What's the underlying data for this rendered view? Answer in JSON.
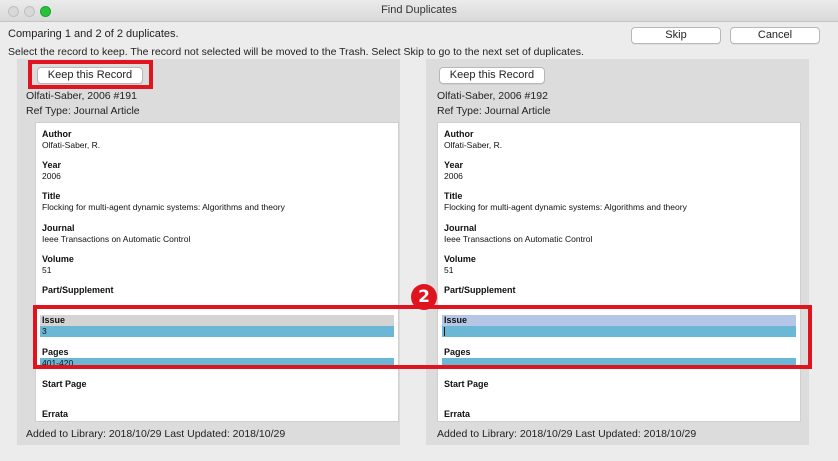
{
  "window": {
    "title": "Find Duplicates"
  },
  "info": {
    "comparing": "Comparing 1 and 2 of 2 duplicates.",
    "instructions": "Select the record to keep. The record not selected will be moved to the Trash. Select Skip to go to the next set of duplicates."
  },
  "buttons": {
    "skip": "Skip",
    "cancel": "Cancel"
  },
  "records": [
    {
      "keep_label": "Keep this Record",
      "name": "Olfati-Saber, 2006 #191",
      "ref_type": "Ref Type:  Journal Article",
      "fields": {
        "author_label": "Author",
        "author": "Olfati-Saber, R.",
        "year_label": "Year",
        "year": "2006",
        "title_label": "Title",
        "title": "Flocking for multi-agent dynamic systems: Algorithms and theory",
        "journal_label": "Journal",
        "journal": "Ieee Transactions on Automatic Control",
        "volume_label": "Volume",
        "volume": "51",
        "part_label": "Part/Supplement",
        "issue_label": "Issue",
        "issue": "3",
        "pages_label": "Pages",
        "pages": "401-420",
        "start_page_label": "Start Page",
        "errata_label": "Errata"
      },
      "footer": "Added to Library: 2018/10/29   Last Updated: 2018/10/29"
    },
    {
      "keep_label": "Keep this Record",
      "name": "Olfati-Saber, 2006 #192",
      "ref_type": "Ref Type:  Journal Article",
      "fields": {
        "author_label": "Author",
        "author": "Olfati-Saber, R.",
        "year_label": "Year",
        "year": "2006",
        "title_label": "Title",
        "title": "Flocking for multi-agent dynamic systems: Algorithms and theory",
        "journal_label": "Journal",
        "journal": "Ieee Transactions on Automatic Control",
        "volume_label": "Volume",
        "volume": "51",
        "part_label": "Part/Supplement",
        "issue_label": "Issue",
        "issue": "",
        "pages_label": "Pages",
        "pages": "",
        "start_page_label": "Start Page",
        "errata_label": "Errata"
      },
      "footer": "Added to Library: 2018/10/29   Last Updated: 2018/10/29"
    }
  ],
  "annotation": {
    "badge": "2",
    "color": "#e0141e"
  },
  "colors": {
    "highlight_value": "#6bb7d6",
    "highlight_label_active": "#b6c6e6"
  }
}
